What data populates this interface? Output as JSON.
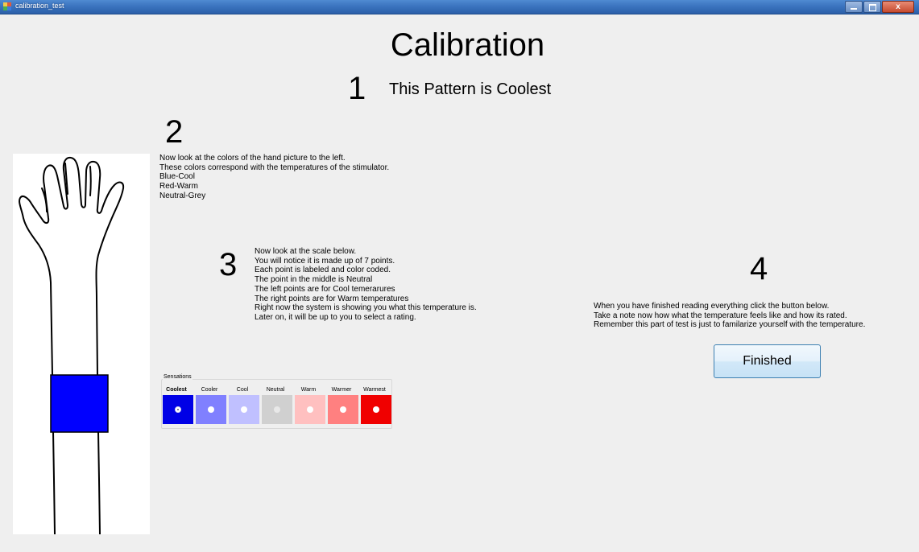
{
  "window": {
    "title": "calibration_test",
    "controls": {
      "minimize": "–",
      "maximize": "□",
      "close": "x"
    }
  },
  "heading": "Calibration",
  "step1": {
    "number": "1",
    "text": "This Pattern is Coolest"
  },
  "step2": {
    "number": "2",
    "text": "Now look at the colors of the hand picture to the left.\nThese colors correspond with the temperatures of the stimulator.\nBlue-Cool\nRed-Warm\nNeutral-Grey"
  },
  "step3": {
    "number": "3",
    "text": "Now look at the scale below.\nYou will notice it is made up of 7 points.\nEach point is labeled and color coded.\nThe point in the middle is Neutral\nThe left points are for Cool temerarures\nThe right points are for Warm temperatures\nRight now the system is showing you what this temperature is.\nLater on, it will be up to you to select a rating."
  },
  "step4": {
    "number": "4",
    "text": "When you have finished reading everything click the button below.\nTake a note now how what the temperature feels like and how its rated.\nRemember this part of test is just to familarize yourself with the temperature."
  },
  "hand": {
    "band_color": "#0000ff",
    "icon": "hand-outline-icon"
  },
  "sensations": {
    "legend": "Sensations",
    "selected_index": 0,
    "items": [
      {
        "label": "Coolest",
        "color": "#0000e6"
      },
      {
        "label": "Cooler",
        "color": "#8080ff"
      },
      {
        "label": "Cool",
        "color": "#c0c0ff"
      },
      {
        "label": "Neutral",
        "color": "#d0d0d0"
      },
      {
        "label": "Warm",
        "color": "#ffc0c0"
      },
      {
        "label": "Warmer",
        "color": "#ff8080"
      },
      {
        "label": "Warmest",
        "color": "#f00000"
      }
    ]
  },
  "finished_button": "Finished"
}
